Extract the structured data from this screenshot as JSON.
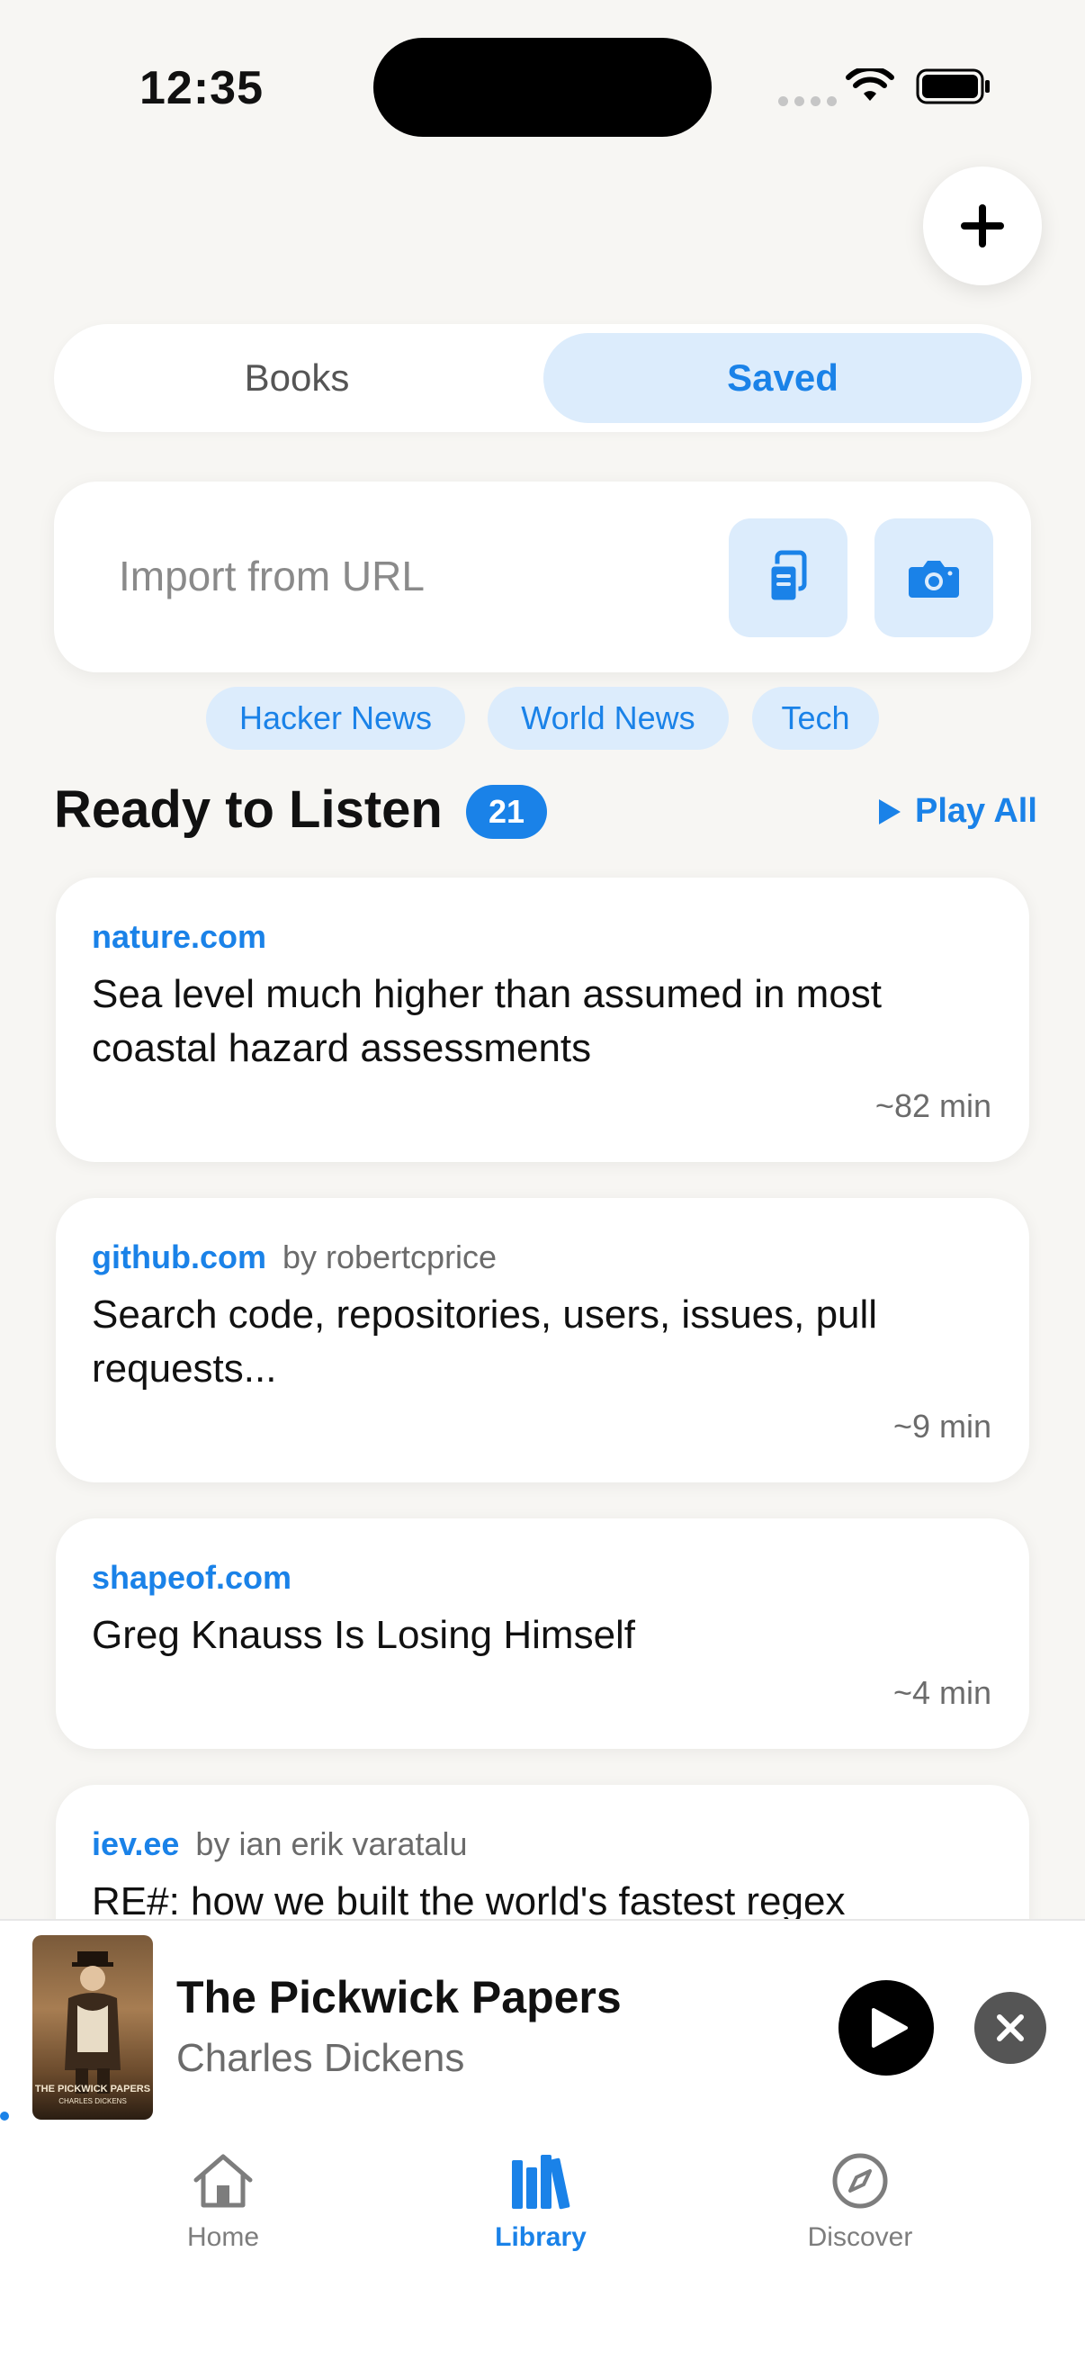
{
  "status_bar": {
    "time": "12:35"
  },
  "segmented": {
    "books_label": "Books",
    "saved_label": "Saved",
    "selected": "Saved"
  },
  "import": {
    "placeholder": "Import from URL"
  },
  "chips": [
    "Hacker News",
    "World News",
    "Tech"
  ],
  "section": {
    "title": "Ready to Listen",
    "count": "21",
    "play_all": "Play All"
  },
  "articles": [
    {
      "domain": "nature.com",
      "author": "",
      "title": "Sea level much higher than assumed in most coastal hazard assessments",
      "duration": "~82 min"
    },
    {
      "domain": "github.com",
      "author": "by robertcprice",
      "title": "Search code, repositories, users, issues, pull requests...",
      "duration": "~9 min"
    },
    {
      "domain": "shapeof.com",
      "author": "",
      "title": "Greg Knauss Is Losing Himself",
      "duration": "~4 min"
    },
    {
      "domain": "iev.ee",
      "author": "by ian erik varatalu",
      "title": "RE#: how we built the world's fastest regex",
      "duration": ""
    }
  ],
  "player": {
    "title": "The Pickwick Papers",
    "author": "Charles Dickens",
    "cover_text": "THE PICKWICK PAPERS",
    "cover_subtext": "CHARLES DICKENS"
  },
  "tabs": [
    {
      "label": "Home",
      "icon": "home-icon",
      "active": false
    },
    {
      "label": "Library",
      "icon": "library-icon",
      "active": true
    },
    {
      "label": "Discover",
      "icon": "compass-icon",
      "active": false
    }
  ],
  "colors": {
    "accent": "#1a82e8",
    "chip_bg": "#dcecfc",
    "background": "#f7f6f3"
  }
}
